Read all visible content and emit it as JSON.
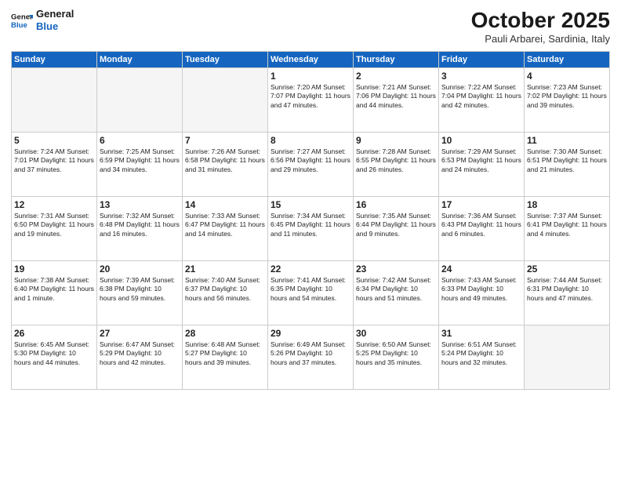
{
  "header": {
    "logo_general": "General",
    "logo_blue": "Blue",
    "month_title": "October 2025",
    "subtitle": "Pauli Arbarei, Sardinia, Italy"
  },
  "days_of_week": [
    "Sunday",
    "Monday",
    "Tuesday",
    "Wednesday",
    "Thursday",
    "Friday",
    "Saturday"
  ],
  "weeks": [
    [
      {
        "day": "",
        "content": ""
      },
      {
        "day": "",
        "content": ""
      },
      {
        "day": "",
        "content": ""
      },
      {
        "day": "1",
        "content": "Sunrise: 7:20 AM\nSunset: 7:07 PM\nDaylight: 11 hours\nand 47 minutes."
      },
      {
        "day": "2",
        "content": "Sunrise: 7:21 AM\nSunset: 7:06 PM\nDaylight: 11 hours\nand 44 minutes."
      },
      {
        "day": "3",
        "content": "Sunrise: 7:22 AM\nSunset: 7:04 PM\nDaylight: 11 hours\nand 42 minutes."
      },
      {
        "day": "4",
        "content": "Sunrise: 7:23 AM\nSunset: 7:02 PM\nDaylight: 11 hours\nand 39 minutes."
      }
    ],
    [
      {
        "day": "5",
        "content": "Sunrise: 7:24 AM\nSunset: 7:01 PM\nDaylight: 11 hours\nand 37 minutes."
      },
      {
        "day": "6",
        "content": "Sunrise: 7:25 AM\nSunset: 6:59 PM\nDaylight: 11 hours\nand 34 minutes."
      },
      {
        "day": "7",
        "content": "Sunrise: 7:26 AM\nSunset: 6:58 PM\nDaylight: 11 hours\nand 31 minutes."
      },
      {
        "day": "8",
        "content": "Sunrise: 7:27 AM\nSunset: 6:56 PM\nDaylight: 11 hours\nand 29 minutes."
      },
      {
        "day": "9",
        "content": "Sunrise: 7:28 AM\nSunset: 6:55 PM\nDaylight: 11 hours\nand 26 minutes."
      },
      {
        "day": "10",
        "content": "Sunrise: 7:29 AM\nSunset: 6:53 PM\nDaylight: 11 hours\nand 24 minutes."
      },
      {
        "day": "11",
        "content": "Sunrise: 7:30 AM\nSunset: 6:51 PM\nDaylight: 11 hours\nand 21 minutes."
      }
    ],
    [
      {
        "day": "12",
        "content": "Sunrise: 7:31 AM\nSunset: 6:50 PM\nDaylight: 11 hours\nand 19 minutes."
      },
      {
        "day": "13",
        "content": "Sunrise: 7:32 AM\nSunset: 6:48 PM\nDaylight: 11 hours\nand 16 minutes."
      },
      {
        "day": "14",
        "content": "Sunrise: 7:33 AM\nSunset: 6:47 PM\nDaylight: 11 hours\nand 14 minutes."
      },
      {
        "day": "15",
        "content": "Sunrise: 7:34 AM\nSunset: 6:45 PM\nDaylight: 11 hours\nand 11 minutes."
      },
      {
        "day": "16",
        "content": "Sunrise: 7:35 AM\nSunset: 6:44 PM\nDaylight: 11 hours\nand 9 minutes."
      },
      {
        "day": "17",
        "content": "Sunrise: 7:36 AM\nSunset: 6:43 PM\nDaylight: 11 hours\nand 6 minutes."
      },
      {
        "day": "18",
        "content": "Sunrise: 7:37 AM\nSunset: 6:41 PM\nDaylight: 11 hours\nand 4 minutes."
      }
    ],
    [
      {
        "day": "19",
        "content": "Sunrise: 7:38 AM\nSunset: 6:40 PM\nDaylight: 11 hours\nand 1 minute."
      },
      {
        "day": "20",
        "content": "Sunrise: 7:39 AM\nSunset: 6:38 PM\nDaylight: 10 hours\nand 59 minutes."
      },
      {
        "day": "21",
        "content": "Sunrise: 7:40 AM\nSunset: 6:37 PM\nDaylight: 10 hours\nand 56 minutes."
      },
      {
        "day": "22",
        "content": "Sunrise: 7:41 AM\nSunset: 6:35 PM\nDaylight: 10 hours\nand 54 minutes."
      },
      {
        "day": "23",
        "content": "Sunrise: 7:42 AM\nSunset: 6:34 PM\nDaylight: 10 hours\nand 51 minutes."
      },
      {
        "day": "24",
        "content": "Sunrise: 7:43 AM\nSunset: 6:33 PM\nDaylight: 10 hours\nand 49 minutes."
      },
      {
        "day": "25",
        "content": "Sunrise: 7:44 AM\nSunset: 6:31 PM\nDaylight: 10 hours\nand 47 minutes."
      }
    ],
    [
      {
        "day": "26",
        "content": "Sunrise: 6:45 AM\nSunset: 5:30 PM\nDaylight: 10 hours\nand 44 minutes."
      },
      {
        "day": "27",
        "content": "Sunrise: 6:47 AM\nSunset: 5:29 PM\nDaylight: 10 hours\nand 42 minutes."
      },
      {
        "day": "28",
        "content": "Sunrise: 6:48 AM\nSunset: 5:27 PM\nDaylight: 10 hours\nand 39 minutes."
      },
      {
        "day": "29",
        "content": "Sunrise: 6:49 AM\nSunset: 5:26 PM\nDaylight: 10 hours\nand 37 minutes."
      },
      {
        "day": "30",
        "content": "Sunrise: 6:50 AM\nSunset: 5:25 PM\nDaylight: 10 hours\nand 35 minutes."
      },
      {
        "day": "31",
        "content": "Sunrise: 6:51 AM\nSunset: 5:24 PM\nDaylight: 10 hours\nand 32 minutes."
      },
      {
        "day": "",
        "content": ""
      }
    ]
  ]
}
